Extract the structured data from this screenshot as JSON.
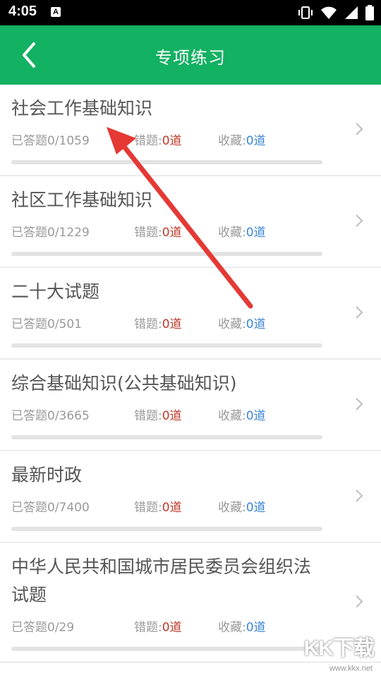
{
  "status_bar": {
    "time": "4:05",
    "notification_icon": "A",
    "icons": [
      "vibrate-icon",
      "wifi-icon",
      "signal-icon",
      "battery-icon"
    ]
  },
  "header": {
    "title": "专项练习",
    "back_icon": "chevron-left-icon",
    "bg_color": "#13b162"
  },
  "labels": {
    "answered": "已答题",
    "wrong": "错题:",
    "favorite": "收藏:"
  },
  "items": [
    {
      "title": "社会工作基础知识",
      "answered": "0/1059",
      "wrong": "0道",
      "favorite": "0道",
      "progress": 0
    },
    {
      "title": "社区工作基础知识",
      "answered": "0/1229",
      "wrong": "0道",
      "favorite": "0道",
      "progress": 0
    },
    {
      "title": "二十大试题",
      "answered": "0/501",
      "wrong": "0道",
      "favorite": "0道",
      "progress": 0
    },
    {
      "title": "综合基础知识(公共基础知识)",
      "answered": "0/3665",
      "wrong": "0道",
      "favorite": "0道",
      "progress": 0
    },
    {
      "title": "最新时政",
      "answered": "0/7400",
      "wrong": "0道",
      "favorite": "0道",
      "progress": 0
    },
    {
      "title": "中华人民共和国城市居民委员会组织法试题",
      "answered": "0/29",
      "wrong": "0道",
      "favorite": "0道",
      "progress": 0
    }
  ],
  "watermark": {
    "text": "KK下载",
    "url": "www.kkx.net"
  }
}
